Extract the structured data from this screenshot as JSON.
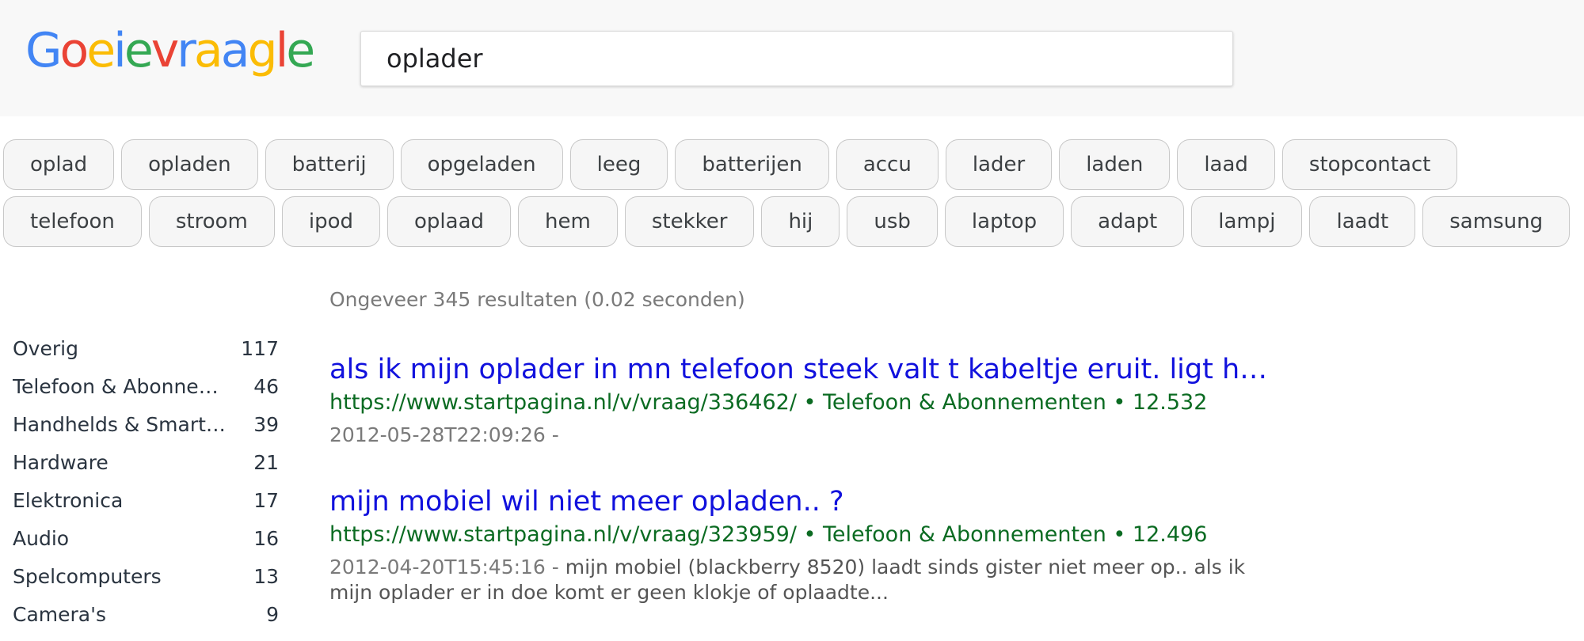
{
  "logo": {
    "letters": [
      {
        "ch": "G",
        "color": "#4285F4"
      },
      {
        "ch": "o",
        "color": "#EA4335"
      },
      {
        "ch": "e",
        "color": "#FBBC05"
      },
      {
        "ch": "i",
        "color": "#4285F4"
      },
      {
        "ch": "e",
        "color": "#34A853"
      },
      {
        "ch": "v",
        "color": "#EA4335"
      },
      {
        "ch": "r",
        "color": "#4285F4"
      },
      {
        "ch": "a",
        "color": "#FBBC05"
      },
      {
        "ch": "a",
        "color": "#4285F4"
      },
      {
        "ch": "g",
        "color": "#FBBC05"
      },
      {
        "ch": "l",
        "color": "#EA4335"
      },
      {
        "ch": "e",
        "color": "#34A853"
      }
    ]
  },
  "search": {
    "value": "oplader"
  },
  "chips": {
    "row1": [
      "oplad",
      "opladen",
      "batterij",
      "opgeladen",
      "leeg",
      "batterijen",
      "accu",
      "lader",
      "laden",
      "laad",
      "stopcontact"
    ],
    "row2": [
      "telefoon",
      "stroom",
      "ipod",
      "oplaad",
      "hem",
      "stekker",
      "hij",
      "usb",
      "laptop",
      "adapt",
      "lampj",
      "laadt",
      "samsung"
    ]
  },
  "sidebar": {
    "categories": [
      {
        "name": "Overig",
        "count": "117"
      },
      {
        "name": "Telefoon & Abonnementen",
        "count": "46"
      },
      {
        "name": "Handhelds & Smartphones",
        "count": "39"
      },
      {
        "name": "Hardware",
        "count": "21"
      },
      {
        "name": "Elektronica",
        "count": "17"
      },
      {
        "name": "Audio",
        "count": "16"
      },
      {
        "name": "Spelcomputers",
        "count": "13"
      },
      {
        "name": "Camera's",
        "count": "9"
      }
    ]
  },
  "results": {
    "stats": "Ongeveer 345 resultaten (0.02 seconden)",
    "items": [
      {
        "title": "als ik mijn oplader in mn telefoon steek valt t kabeltje eruit. ligt het aan mijn telefoon of aan de oplader?",
        "url": "https://www.startpagina.nl/v/vraag/336462/ • Telefoon & Abonnementen • 12.532",
        "date": "2012-05-28T22:09:26 -",
        "snippet": ""
      },
      {
        "title": "mijn mobiel wil niet meer opladen.. ?",
        "url": "https://www.startpagina.nl/v/vraag/323959/ • Telefoon & Abonnementen • 12.496",
        "date": "2012-04-20T15:45:16 -",
        "snippet": "mijn mobiel (blackberry 8520) laadt sinds gister niet meer op.. als ik mijn oplader er in doe komt er geen klokje of oplaadte..."
      }
    ]
  }
}
